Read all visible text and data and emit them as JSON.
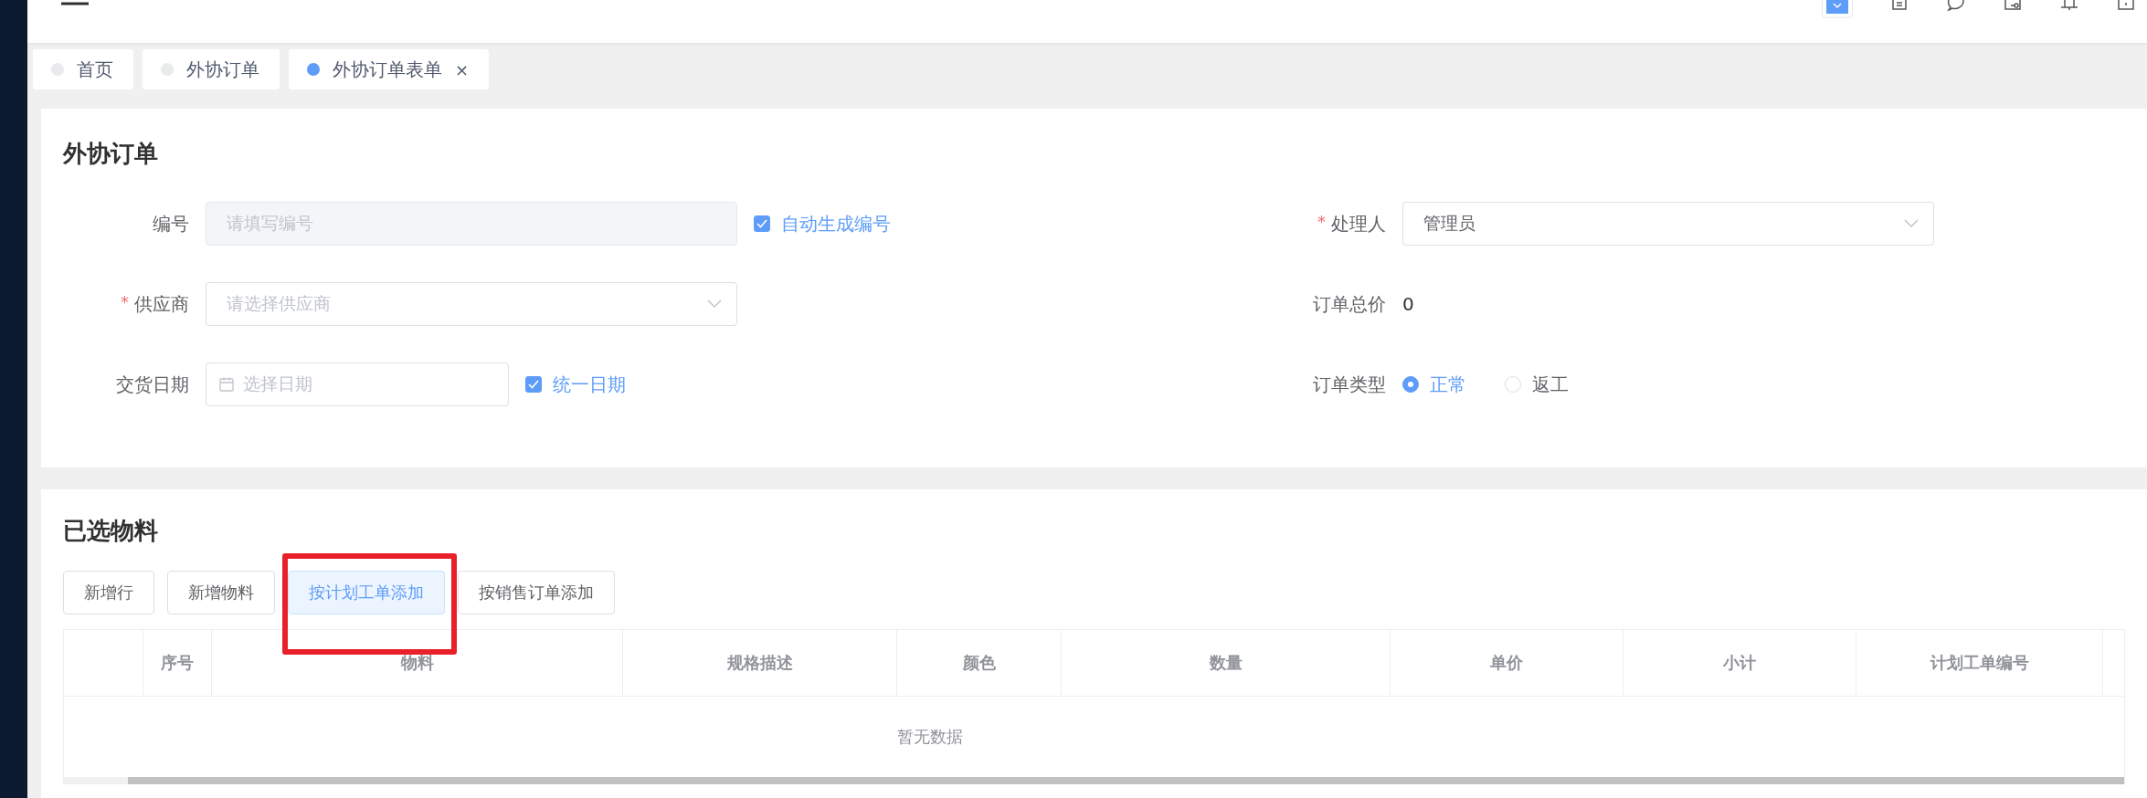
{
  "tabs": [
    {
      "label": "首页",
      "selected": false
    },
    {
      "label": "外协订单",
      "selected": false
    },
    {
      "label": "外协订单表单",
      "selected": true,
      "close_glyph": "×"
    }
  ],
  "order_section": {
    "title": "外协订单",
    "fields_left": [
      {
        "kind": "input",
        "label": "编号",
        "placeholder": "请填写编号",
        "disabled": true,
        "checkbox": {
          "label": "自动生成编号",
          "checked": true
        }
      },
      {
        "kind": "select",
        "label": "供应商",
        "required_mark": "*",
        "placeholder": "请选择供应商"
      },
      {
        "kind": "date",
        "label": "交货日期",
        "placeholder": "选择日期",
        "checkbox": {
          "label": "统一日期",
          "checked": true
        }
      }
    ],
    "fields_right": [
      {
        "kind": "select",
        "label": "处理人",
        "required_mark": "*",
        "value": "管理员"
      },
      {
        "kind": "text",
        "label": "订单总价",
        "value": "0"
      },
      {
        "kind": "radio",
        "label": "订单类型",
        "options": [
          {
            "label": "正常",
            "selected": true
          },
          {
            "label": "返工",
            "selected": false
          }
        ]
      }
    ]
  },
  "materials_section": {
    "title": "已选物料",
    "buttons": [
      {
        "label": "新增行",
        "highlighted": false,
        "annotated": false
      },
      {
        "label": "新增物料",
        "highlighted": false,
        "annotated": false
      },
      {
        "label": "按计划工单添加",
        "highlighted": true,
        "annotated": true
      },
      {
        "label": "按销售订单添加",
        "highlighted": false,
        "annotated": false
      }
    ],
    "table": {
      "columns": [
        {
          "label": "序号"
        },
        {
          "label": "物料"
        },
        {
          "label": "规格描述"
        },
        {
          "label": "颜色"
        },
        {
          "label": "数量"
        },
        {
          "label": "单价"
        },
        {
          "label": "小计"
        },
        {
          "label": "计划工单编号"
        }
      ],
      "empty_text": "暂无数据"
    }
  }
}
